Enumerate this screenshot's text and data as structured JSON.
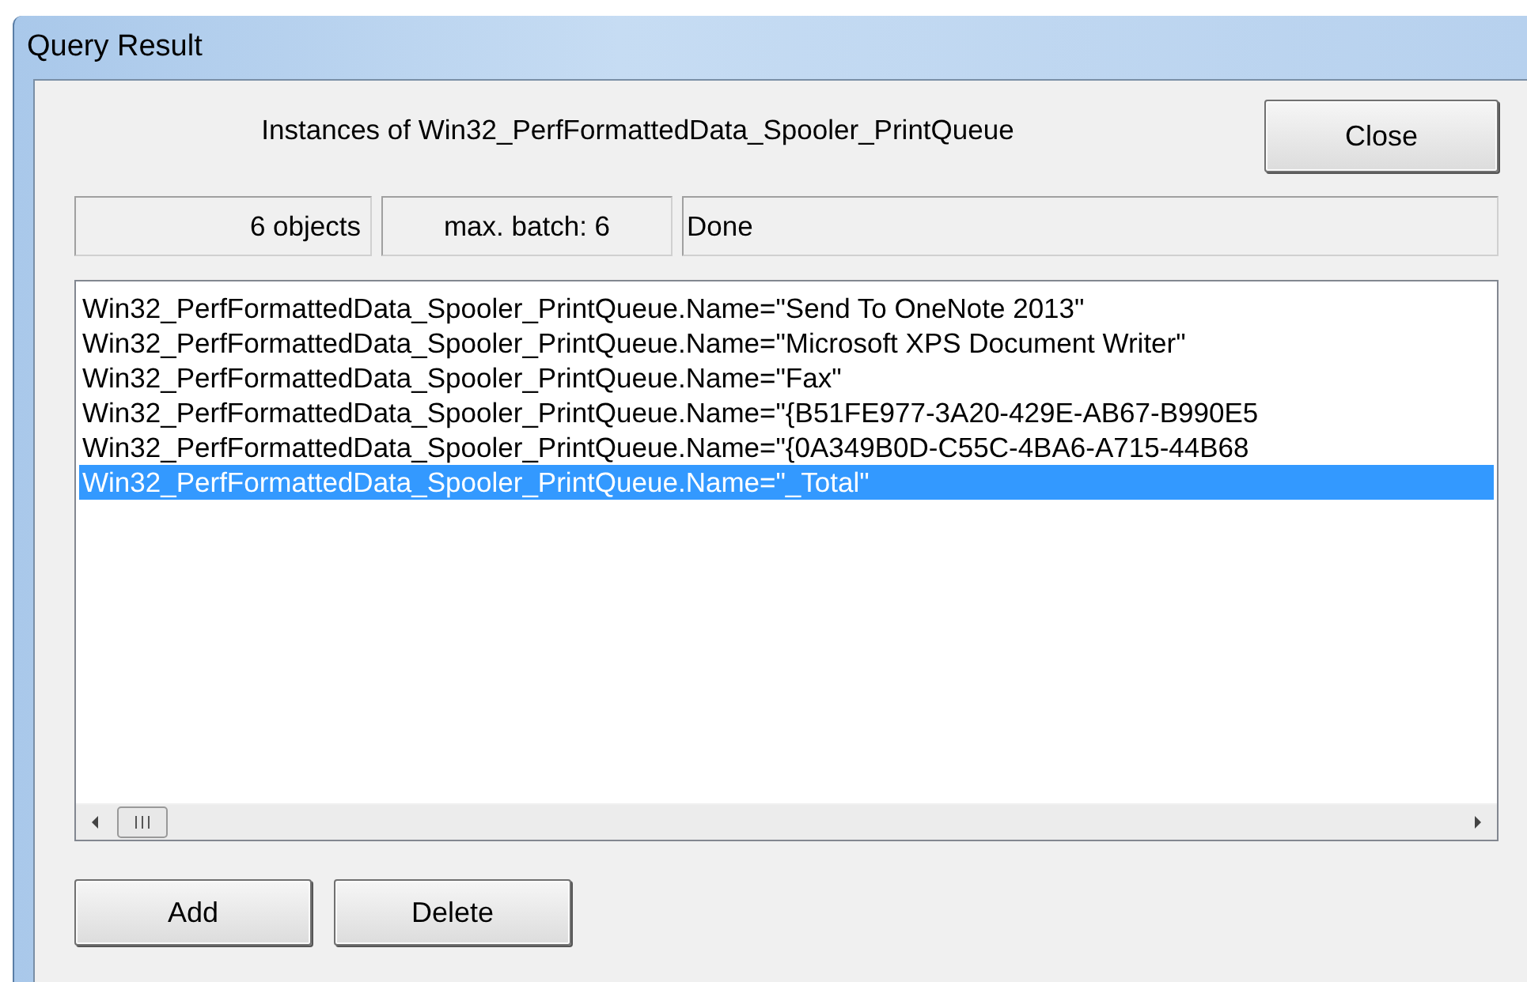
{
  "window": {
    "title": "Query Result"
  },
  "heading": "Instances of Win32_PerfFormattedData_Spooler_PrintQueue",
  "close_button": "Close",
  "status_bar": [
    "6 objects",
    "max. batch: 6",
    "Done"
  ],
  "results": [
    {
      "text": "Win32_PerfFormattedData_Spooler_PrintQueue.Name=\"Send To OneNote 2013\"",
      "selected": false
    },
    {
      "text": "Win32_PerfFormattedData_Spooler_PrintQueue.Name=\"Microsoft XPS Document Writer\"",
      "selected": false
    },
    {
      "text": "Win32_PerfFormattedData_Spooler_PrintQueue.Name=\"Fax\"",
      "selected": false
    },
    {
      "text": "Win32_PerfFormattedData_Spooler_PrintQueue.Name=\"{B51FE977-3A20-429E-AB67-B990E5",
      "selected": false
    },
    {
      "text": "Win32_PerfFormattedData_Spooler_PrintQueue.Name=\"{0A349B0D-C55C-4BA6-A715-44B68",
      "selected": false
    },
    {
      "text": "Win32_PerfFormattedData_Spooler_PrintQueue.Name=\"_Total\"",
      "selected": true
    }
  ],
  "buttons": [
    "Add",
    "Delete"
  ]
}
